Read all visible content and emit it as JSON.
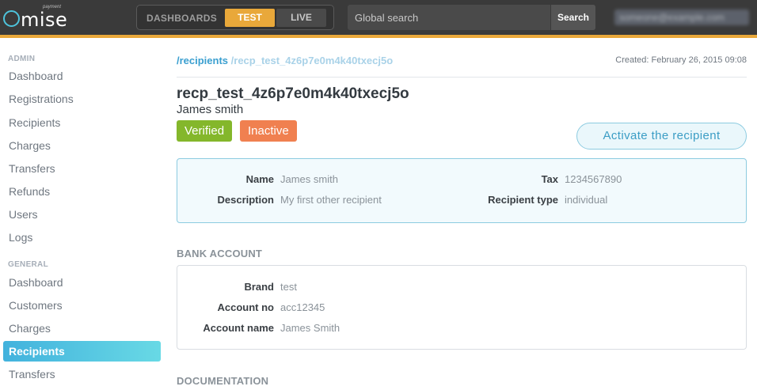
{
  "brand": {
    "logo_text": "mise",
    "logo_tag": "payment"
  },
  "topbar": {
    "dashboards_label": "DASHBOARDS",
    "test_label": "TEST",
    "live_label": "LIVE",
    "search_placeholder": "Global search",
    "search_button": "Search",
    "user_email": "someone@example.com"
  },
  "sidebar": {
    "admin_header": "ADMIN",
    "admin_items": [
      "Dashboard",
      "Registrations",
      "Recipients",
      "Charges",
      "Transfers",
      "Refunds",
      "Users",
      "Logs"
    ],
    "general_header": "GENERAL",
    "general_items": [
      "Dashboard",
      "Customers",
      "Charges",
      "Recipients",
      "Transfers"
    ],
    "active_item": "Recipients"
  },
  "breadcrumb": {
    "parent": "/recipients",
    "current": "/recp_test_4z6p7e0m4k40txecj5o"
  },
  "created": "Created: February 26, 2015 09:08",
  "recipient": {
    "id": "recp_test_4z6p7e0m4k40txecj5o",
    "name": "James smith",
    "badge_verified": "Verified",
    "badge_status": "Inactive",
    "activate_button": "Activate the recipient",
    "details": {
      "name_label": "Name",
      "name_value": "James smith",
      "description_label": "Description",
      "description_value": "My first other recipient",
      "tax_label": "Tax",
      "tax_value": "1234567890",
      "type_label": "Recipient type",
      "type_value": "individual"
    }
  },
  "bank_account": {
    "header": "BANK ACCOUNT",
    "brand_label": "Brand",
    "brand_value": "test",
    "account_no_label": "Account no",
    "account_no_value": "acc12345",
    "account_name_label": "Account name",
    "account_name_value": "James Smith"
  },
  "documentation": {
    "header": "DOCUMENTATION"
  },
  "colors": {
    "accent": "#e9a83a",
    "brand_blue": "#3a9fd0",
    "verified": "#84b72b",
    "inactive": "#f08050"
  }
}
